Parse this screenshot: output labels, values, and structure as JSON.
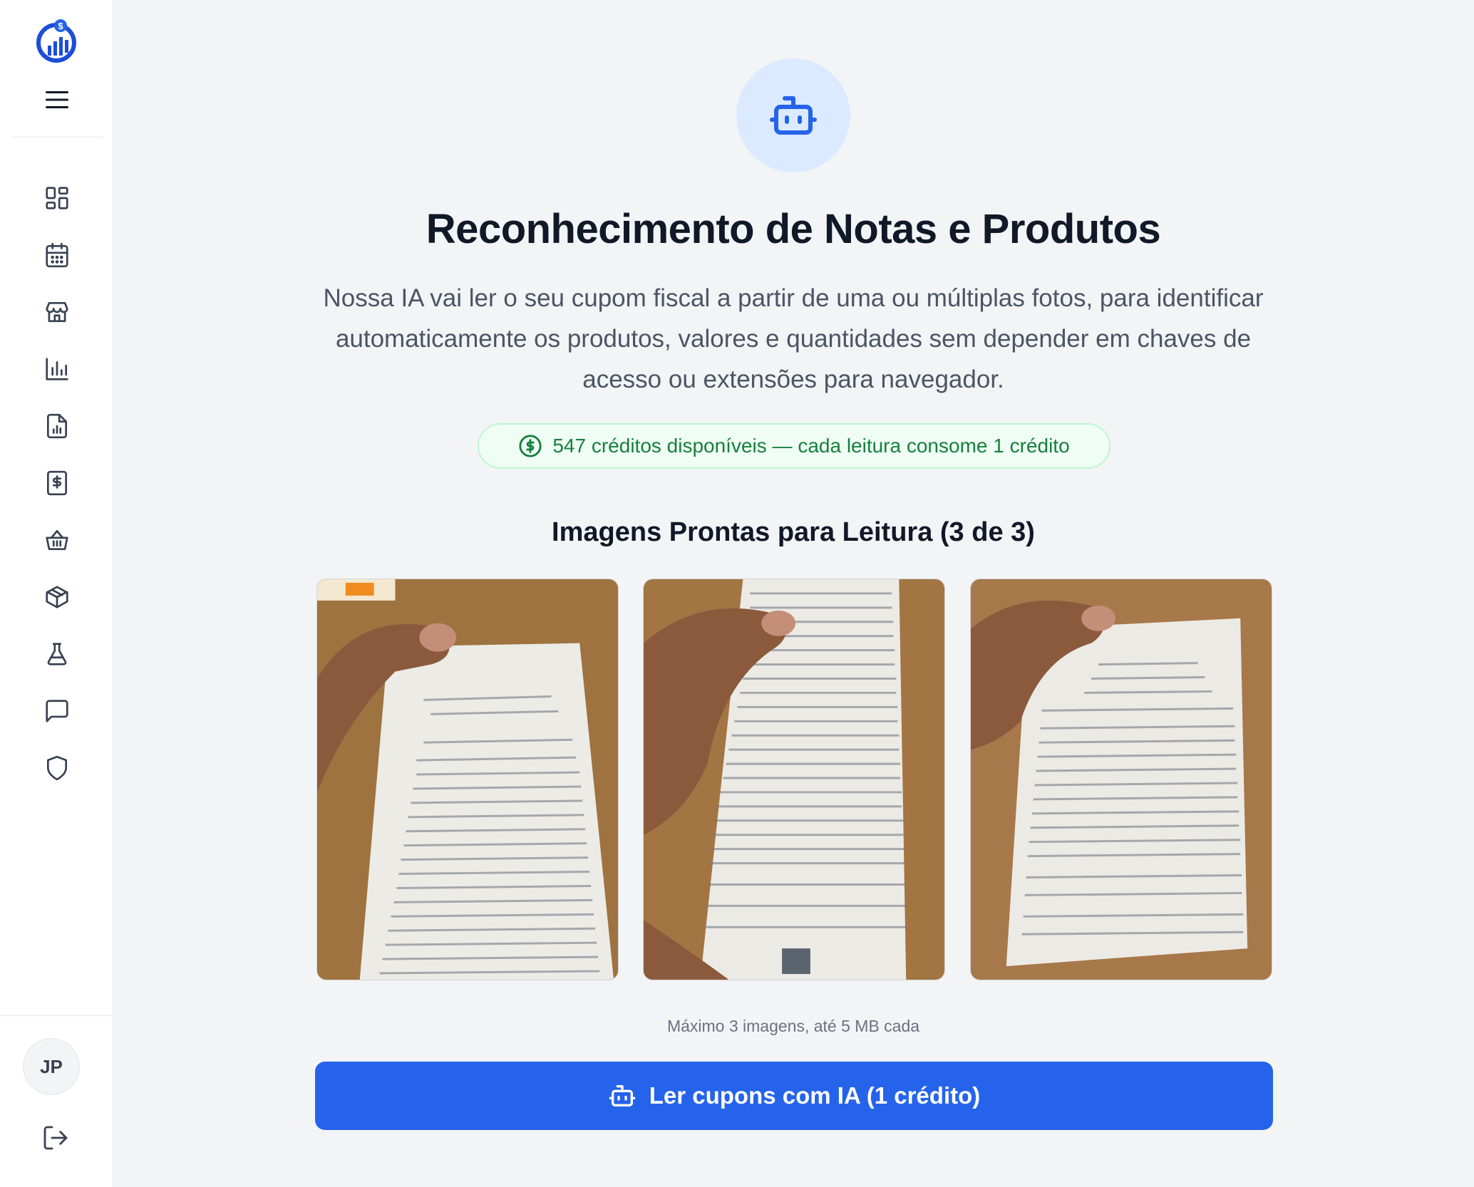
{
  "sidebar": {
    "user_initials": "JP",
    "nav_icons": [
      "dashboard-icon",
      "calendar-icon",
      "store-icon",
      "bar-chart-icon",
      "report-file-icon",
      "receipt-dollar-icon",
      "basket-icon",
      "box-icon",
      "flask-icon",
      "chat-icon",
      "shield-icon"
    ]
  },
  "main": {
    "title": "Reconhecimento de Notas e Produtos",
    "subtitle": "Nossa IA vai ler o seu cupom fiscal a partir de uma ou múltiplas fotos, para identificar automaticamente os produtos, valores e quantidades sem depender em chaves de acesso ou extensões para navegador.",
    "credits_text": "547 créditos disponíveis — cada leitura consome 1 crédito",
    "images_title": "Imagens Prontas para Leitura (3 de 3)",
    "limit_text": "Máximo 3 imagens, até 5 MB cada",
    "read_button": "Ler cupons com IA (1 crédito)"
  },
  "colors": {
    "primary": "#2563eb",
    "credits_green": "#15803d",
    "bot_circle_bg": "#dbeafe"
  }
}
